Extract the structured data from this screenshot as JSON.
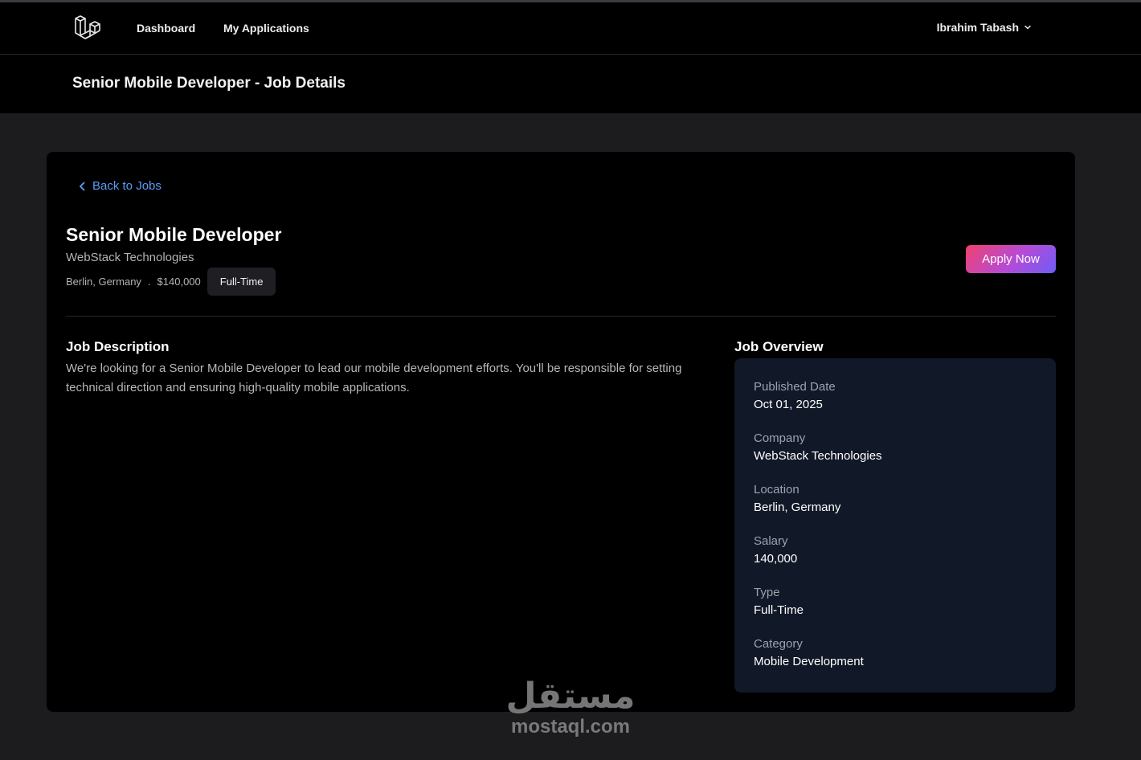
{
  "nav": {
    "links": [
      "Dashboard",
      "My Applications"
    ],
    "user_name": "Ibrahim Tabash"
  },
  "header": {
    "title": "Senior Mobile Developer - Job Details"
  },
  "job": {
    "back_label": "Back to Jobs",
    "title": "Senior Mobile Developer",
    "company": "WebStack Technologies",
    "location": "Berlin, Germany",
    "separator": ".",
    "salary": "$140,000",
    "type": "Full-Time",
    "apply_label": "Apply Now",
    "description_heading": "Job Description",
    "description": "We're looking for a Senior Mobile Developer to lead our mobile development efforts. You'll be responsible for setting technical direction and ensuring high-quality mobile applications."
  },
  "overview": {
    "heading": "Job Overview",
    "items": [
      {
        "label": "Published Date",
        "value": "Oct 01, 2025"
      },
      {
        "label": "Company",
        "value": "WebStack Technologies"
      },
      {
        "label": "Location",
        "value": "Berlin, Germany"
      },
      {
        "label": "Salary",
        "value": "140,000"
      },
      {
        "label": "Type",
        "value": "Full-Time"
      },
      {
        "label": "Category",
        "value": "Mobile Development"
      }
    ]
  },
  "watermark": {
    "arabic": "مستقل",
    "latin": "mostaql.com"
  },
  "colors": {
    "accent_link": "#5b9cf5",
    "apply_gradient_start": "#f0416e",
    "apply_gradient_end": "#6c5ef5",
    "overview_bg": "#111827"
  }
}
